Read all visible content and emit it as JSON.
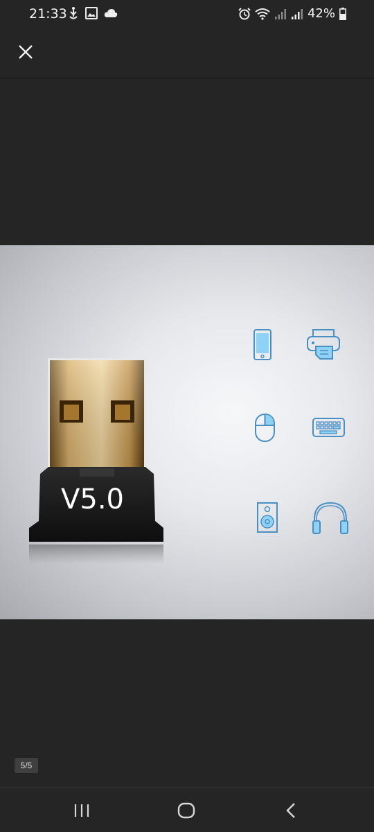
{
  "status_bar": {
    "time": "21:33",
    "battery_percent": "42%",
    "left_icons": [
      "usb-tether-icon",
      "gallery-icon",
      "cloud-icon"
    ],
    "right_icons": [
      "alarm-icon",
      "wifi-icon",
      "signal-icon",
      "signal-icon",
      "battery-icon"
    ]
  },
  "viewer": {
    "close_icon": "close-icon",
    "counter": "5/5"
  },
  "product_image": {
    "label": "V5.0",
    "device_icons": [
      "phone-icon",
      "printer-icon",
      "mouse-icon",
      "keyboard-icon",
      "speaker-icon",
      "headphones-icon"
    ],
    "icon_color": "#4a8fc4",
    "icon_fill": "#8fd2f5"
  },
  "nav_bar": {
    "buttons": [
      "recent-apps-icon",
      "home-icon",
      "back-icon"
    ]
  }
}
